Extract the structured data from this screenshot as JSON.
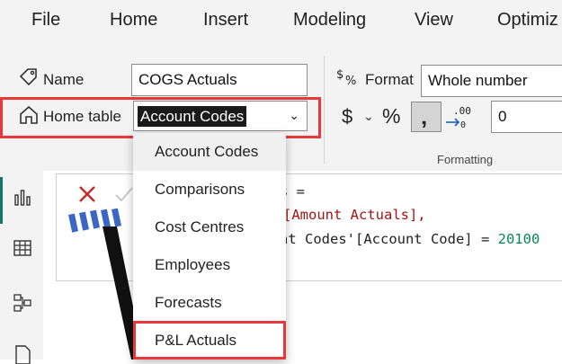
{
  "menu": {
    "items": [
      {
        "label": "File"
      },
      {
        "label": "Home"
      },
      {
        "label": "Insert"
      },
      {
        "label": "Modeling"
      },
      {
        "label": "View"
      },
      {
        "label": "Optimiz"
      }
    ]
  },
  "ribbon": {
    "name_label": "Name",
    "name_value": "COGS Actuals",
    "home_table_label": "Home table",
    "home_table_value": "Account Codes",
    "format_label": "Format",
    "format_value": "Whole number",
    "currency_symbol": "$",
    "percent_symbol": "%",
    "comma_symbol": "̕",
    "decimals_value": "0",
    "group_caption": "Formatting"
  },
  "formula": {
    "line1": "s =",
    "line2": "[Amount Actuals],",
    "line3_a": "nt Codes'[Account Code] = ",
    "line3_b": "20100"
  },
  "dropdown": {
    "options": [
      {
        "label": "Account Codes"
      },
      {
        "label": "Comparisons"
      },
      {
        "label": "Cost Centres"
      },
      {
        "label": "Employees"
      },
      {
        "label": "Forecasts"
      },
      {
        "label": "P&L Actuals"
      }
    ]
  },
  "colors": {
    "highlight_red": "#e8383d",
    "accent_teal": "#117865",
    "number_green": "#098658",
    "column_purple": "#a31515"
  }
}
